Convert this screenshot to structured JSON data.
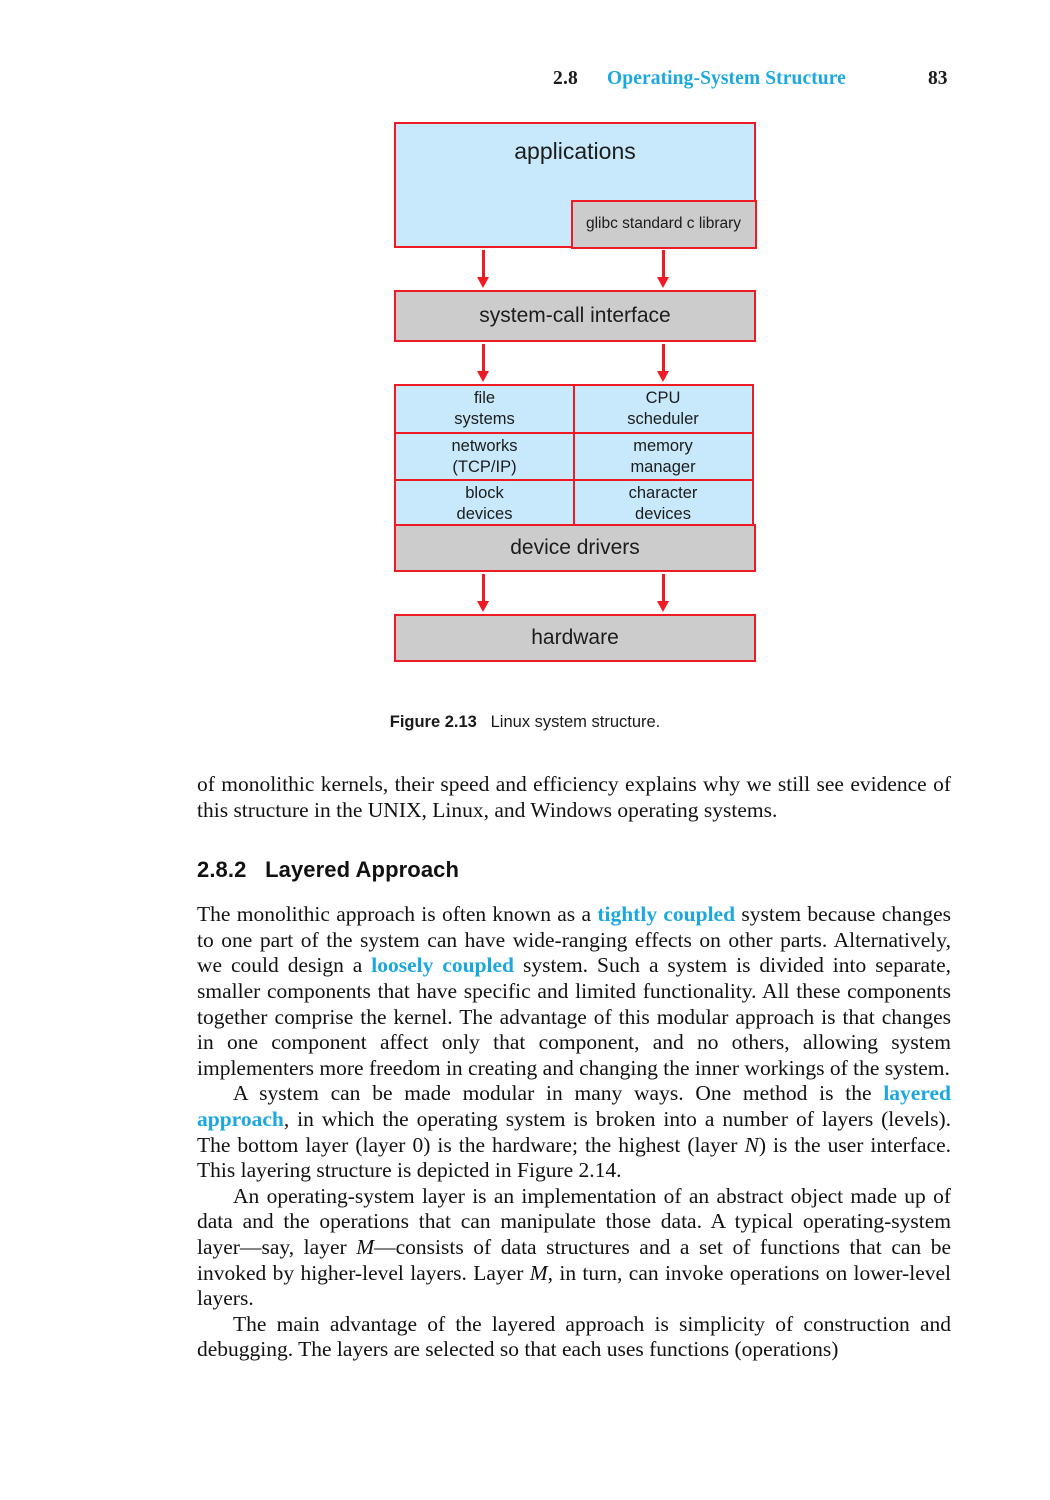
{
  "running_head": {
    "section_number": "2.8",
    "section_title": "Operating-System Structure",
    "page_number": "83",
    "accent_color": "#1ba7e0"
  },
  "figure": {
    "applications_label": "applications",
    "glibc_label": "glibc standard c library",
    "syscall_label": "system-call interface",
    "kernel_cells": [
      {
        "line1": "file",
        "line2": "systems"
      },
      {
        "line1": "CPU",
        "line2": "scheduler"
      },
      {
        "line1": "networks",
        "line2": "(TCP/IP)"
      },
      {
        "line1": "memory",
        "line2": "manager"
      },
      {
        "line1": "block",
        "line2": "devices"
      },
      {
        "line1": "character",
        "line2": "devices"
      }
    ],
    "device_drivers_label": "device drivers",
    "hardware_label": "hardware",
    "caption_label": "Figure 2.13",
    "caption_text": "Linux system structure.",
    "colors": {
      "box_border": "#ee1b24",
      "blue_fill": "#c7e9fb",
      "grey_fill": "#cccccc",
      "arrow": "#ee1b24"
    }
  },
  "body": {
    "paragraph_1_a": "of monolithic kernels, their speed and efficiency explains why we still see evidence of this structure in the ",
    "paragraph_1_unix": "UNIX",
    "paragraph_1_b": ", Linux, and Windows operating systems.",
    "section_heading_number": "2.8.2",
    "section_heading_title": "Layered Approach",
    "paragraph_2_a": "The monolithic approach is often known as a ",
    "paragraph_2_em1": "tightly coupled",
    "paragraph_2_b": " system because changes to one part of the system can have wide-ranging effects on other parts. Alternatively, we could design a ",
    "paragraph_2_em2": "loosely coupled",
    "paragraph_2_c": " system. Such a system is divided into separate, smaller components that have specific and limited functionality. All these components together comprise the kernel. The advantage of this modular approach is that changes in one component affect only that component, and no others, allowing system implementers more freedom in creating and changing the inner workings of the system.",
    "paragraph_3_a": "A system can be made modular in many ways. One method is the ",
    "paragraph_3_em": "layered approach",
    "paragraph_3_b": ", in which the operating system is broken into a number of layers (levels). The bottom layer (layer 0) is the hardware; the highest (layer ",
    "paragraph_3_var": "N",
    "paragraph_3_c": ") is the user interface. This layering structure is depicted in Figure 2.14.",
    "paragraph_4_a": "An operating-system layer is an implementation of an abstract object made up of data and the operations that can manipulate those data. A typical operating-system layer—say, layer ",
    "paragraph_4_var1": "M",
    "paragraph_4_b": "—consists of data structures and a set of functions that can be invoked by higher-level layers. Layer ",
    "paragraph_4_var2": "M",
    "paragraph_4_c": ", in turn, can invoke operations on lower-level layers.",
    "paragraph_5": "The main advantage of the layered approach is simplicity of construction and debugging. The layers are selected so that each uses functions (operations)"
  }
}
